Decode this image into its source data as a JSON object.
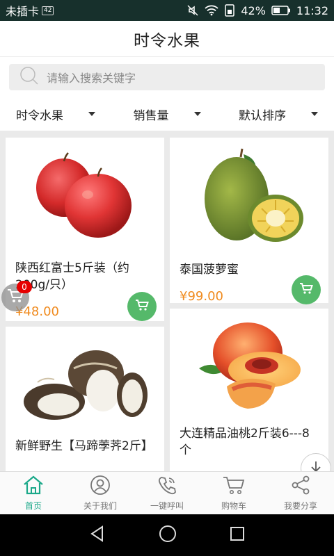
{
  "status_bar": {
    "carrier": "未插卡",
    "sim_badge": "42",
    "battery_text": "42%",
    "time": "11:32"
  },
  "header": {
    "title": "时令水果"
  },
  "search": {
    "placeholder": "请输入搜索关键字"
  },
  "filters": [
    {
      "label": "时令水果"
    },
    {
      "label": "销售量"
    },
    {
      "label": "默认排序"
    }
  ],
  "products": [
    {
      "name": "陕西红富士5斤装（约200g/只）",
      "price": "¥48.00",
      "image": "red-apples"
    },
    {
      "name": "泰国菠萝蜜",
      "price": "¥99.00",
      "image": "jackfruit"
    },
    {
      "name": "新鲜野生【马蹄荸荠2斤】",
      "price": "",
      "image": "water-chestnut"
    },
    {
      "name": "大连精品油桃2斤装6---8个",
      "price": "",
      "image": "nectarine"
    }
  ],
  "floating_cart": {
    "count": "0"
  },
  "bottom_nav": [
    {
      "label": "首页",
      "icon": "home-icon",
      "active": true
    },
    {
      "label": "关于我们",
      "icon": "user-icon",
      "active": false
    },
    {
      "label": "一键呼叫",
      "icon": "phone-icon",
      "active": false
    },
    {
      "label": "购物车",
      "icon": "cart-icon",
      "active": false
    },
    {
      "label": "我要分享",
      "icon": "share-icon",
      "active": false
    }
  ],
  "colors": {
    "accent": "#1aa889",
    "price": "#f08b1f",
    "cart_button": "#55b96a",
    "status_bar": "#17302c"
  }
}
